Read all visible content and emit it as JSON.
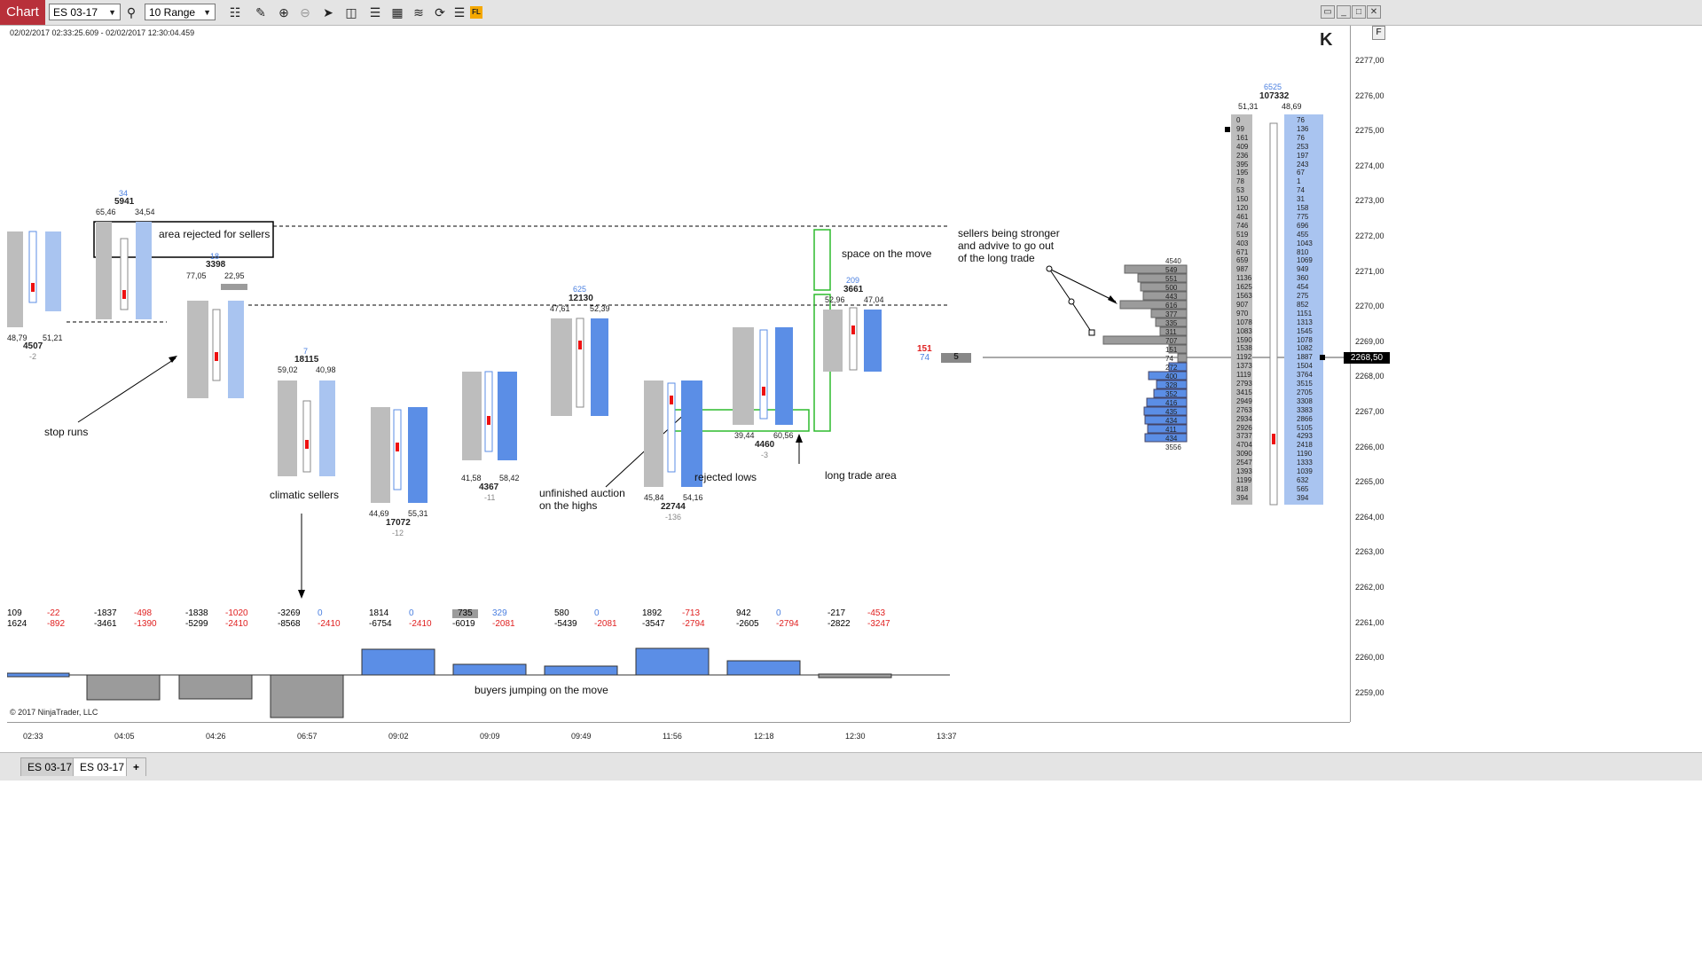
{
  "toolbar": {
    "chart_label": "Chart",
    "instrument": "ES 03-17",
    "bar_type": "10 Range",
    "icons": [
      "search-icon",
      "bar-chart-icon",
      "pencil-icon",
      "zoom-in-icon",
      "zoom-out-icon",
      "pointer-icon",
      "data-box-icon",
      "properties-icon",
      "strategies-icon",
      "indicators-icon",
      "reload-icon",
      "list-icon",
      "fl-badge-icon"
    ],
    "fl_badge": "FL",
    "colors": {
      "chart_label_bg": "#b8303a",
      "fl_badge_bg": "#f5a800"
    }
  },
  "chart": {
    "date_range": "02/02/2017 02:33:25.609 - 02/02/2017 12:30:04.459",
    "copyright": "© 2017 NinjaTrader, LLC",
    "price_axis": [
      "2277,00",
      "2276,00",
      "2275,00",
      "2274,00",
      "2273,00",
      "2272,00",
      "2271,00",
      "2270,00",
      "2269,00",
      "2268,00",
      "2267,00",
      "2266,00",
      "2265,00",
      "2264,00",
      "2263,00",
      "2262,00",
      "2261,00",
      "2260,00",
      "2259,00"
    ],
    "current_price": "2268,50",
    "time_axis": [
      "02:33",
      "04:05",
      "04:26",
      "06:57",
      "09:02",
      "09:09",
      "09:49",
      "11:56",
      "12:18",
      "12:30",
      "13:37"
    ],
    "annotations": {
      "area_rejected": "area rejected for sellers",
      "stop_runs": "stop runs",
      "climatic_sellers": "climatic sellers",
      "unfinished_auction": "unfinished auction\non the highs",
      "rejected_lows": "rejected lows",
      "space_on_move": "space on the move",
      "long_trade_area": "long trade area",
      "sellers_stronger": "sellers being stronger\nand advive to go out\nof the long trade",
      "buyers_jumping": "buyers jumping on the move"
    },
    "bar_stats": [
      {
        "delta_top": "34",
        "volume": "5941",
        "left": "65,46",
        "right": "34,54"
      },
      {
        "delta_top": "18",
        "volume": "3398",
        "left": "77,05",
        "right": "22,95"
      },
      {
        "delta_top": "7",
        "volume": "18115",
        "left": "59,02",
        "right": "40,98"
      },
      {
        "delta_top": "625",
        "volume": "12130",
        "left": "47,61",
        "right": "52,39"
      },
      {
        "delta_top": "209",
        "volume": "3661",
        "left": "52,96",
        "right": "47,04"
      },
      {
        "delta_top": "6525",
        "volume": "107332",
        "left": "51,31",
        "right": "48,69"
      }
    ],
    "bar_bottom_stats": [
      {
        "left": "48,79",
        "right": "51,21",
        "volume": "4507",
        "delta": "-2"
      },
      {
        "left": "44,69",
        "right": "55,31",
        "volume": "17072",
        "delta": "-12"
      },
      {
        "left": "41,58",
        "right": "58,42",
        "volume": "4367",
        "delta": "-11"
      },
      {
        "left": "45,84",
        "right": "54,16",
        "volume": "22744",
        "delta": "-136"
      },
      {
        "left": "39,44",
        "right": "60,56",
        "volume": "4460",
        "delta": "-3"
      }
    ],
    "cum_delta": [
      {
        "a": "109",
        "b": "-22",
        "c": "1624",
        "d": "-892"
      },
      {
        "a": "-1837",
        "b": "-498",
        "c": "-3461",
        "d": "-1390"
      },
      {
        "a": "-1838",
        "b": "-1020",
        "c": "-5299",
        "d": "-2410"
      },
      {
        "a": "-3269",
        "b": "0",
        "c": "-8568",
        "d": "-2410"
      },
      {
        "a": "1814",
        "b": "0",
        "c": "-6754",
        "d": "-2410"
      },
      {
        "a": "735",
        "b": "329",
        "c": "-6019",
        "d": "-2081"
      },
      {
        "a": "580",
        "b": "0",
        "c": "-5439",
        "d": "-2081"
      },
      {
        "a": "1892",
        "b": "-713",
        "c": "-3547",
        "d": "-2794"
      },
      {
        "a": "942",
        "b": "0",
        "c": "-2605",
        "d": "-2794"
      },
      {
        "a": "-217",
        "b": "-453",
        "c": "-2822",
        "d": "-3247"
      }
    ],
    "last_price_box": {
      "bid": "151",
      "ask": "74",
      "size": "5"
    },
    "profile_values": [
      "4540",
      "549",
      "551",
      "500",
      "443",
      "616",
      "377",
      "335",
      "311",
      "707",
      "151",
      "74",
      "272",
      "400",
      "328",
      "352",
      "416",
      "435",
      "434",
      "411",
      "434",
      "3556"
    ],
    "right_ladder_left": [
      "0",
      "99",
      "161",
      "409",
      "236",
      "395",
      "195",
      "78",
      "53",
      "150",
      "120",
      "461",
      "746",
      "519",
      "403",
      "671",
      "659",
      "987",
      "1136",
      "1625",
      "1563",
      "907",
      "970",
      "1078",
      "1083",
      "1590",
      "1538",
      "1192",
      "1373",
      "1119",
      "2793",
      "3415",
      "2949",
      "2763",
      "2934",
      "2926",
      "3737",
      "4704",
      "3090",
      "2547",
      "1393",
      "1199",
      "818",
      "394"
    ],
    "right_ladder_right": [
      "76",
      "136",
      "76",
      "253",
      "197",
      "243",
      "67",
      "1",
      "74",
      "31",
      "158",
      "775",
      "696",
      "455",
      "1043",
      "810",
      "1069",
      "949",
      "360",
      "454",
      "275",
      "852",
      "1151",
      "1313",
      "1545",
      "1078",
      "1082",
      "1887",
      "1504",
      "3764",
      "3515",
      "2705",
      "3308",
      "3383",
      "2866",
      "5105",
      "4293",
      "2418",
      "1190",
      "1333",
      "1039",
      "632",
      "565",
      "394"
    ],
    "colors": {
      "ask_blue": "#5b8ee6",
      "bid_gray": "#9b9b9b",
      "annotation_green": "#2dbb2d",
      "delta_red": "#e02020",
      "delta_blue": "#4a7fe0"
    }
  },
  "tabs": {
    "items": [
      "ES 03-17",
      "ES 03-17"
    ],
    "active": 1,
    "add_label": "+"
  },
  "window": {
    "f_label": "F"
  }
}
